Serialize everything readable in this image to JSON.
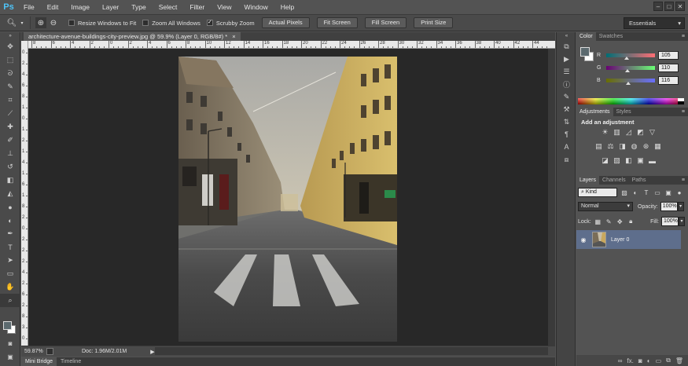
{
  "app": {
    "logo": "Ps"
  },
  "menu": [
    "File",
    "Edit",
    "Image",
    "Layer",
    "Type",
    "Select",
    "Filter",
    "View",
    "Window",
    "Help"
  ],
  "window_controls": {
    "minimize": "–",
    "maximize": "□",
    "close": "✕"
  },
  "options_bar": {
    "resize_windows": "Resize Windows to Fit",
    "zoom_all": "Zoom All Windows",
    "scrubby_zoom": "Scrubby Zoom",
    "scrubby_checked": true,
    "actual_pixels": "Actual Pixels",
    "fit_screen": "Fit Screen",
    "fill_screen": "Fill Screen",
    "print_size": "Print Size",
    "workspace": "Essentials"
  },
  "document": {
    "tab_title": "architecture-avenue-buildings-city-preview.jpg @ 59.9% (Layer 0, RGB/8#) *",
    "tab_close": "×"
  },
  "rulers": {
    "h_labels": [
      "8",
      "6",
      "4",
      "2",
      "0",
      "2",
      "4",
      "6",
      "8",
      "10",
      "12",
      "14",
      "16",
      "18",
      "20",
      "22",
      "24",
      "26",
      "28",
      "30",
      "32",
      "34",
      "36",
      "38",
      "40",
      "42",
      "44"
    ],
    "v_labels": [
      "0",
      "2",
      "4",
      "6",
      "8",
      "1",
      "0",
      "1",
      "2",
      "1",
      "4",
      "1",
      "6",
      "1",
      "8",
      "2",
      "0",
      "2",
      "2",
      "2",
      "4",
      "2",
      "6",
      "2",
      "8",
      "3",
      "0"
    ]
  },
  "status": {
    "zoom": "59.87%",
    "doc": "Doc: 1.96M/2.01M",
    "arrow": "▶"
  },
  "mini": {
    "bridge": "Mini Bridge",
    "timeline": "Timeline"
  },
  "color_panel": {
    "tabs": [
      "Color",
      "Swatches"
    ],
    "r_label": "R",
    "g_label": "G",
    "b_label": "B",
    "r": "105",
    "g": "110",
    "b": "116",
    "fg": "#5c6a6f",
    "bg": "#ffffff"
  },
  "adjustments_panel": {
    "tabs": [
      "Adjustments",
      "Styles"
    ],
    "title": "Add an adjustment"
  },
  "layers_panel": {
    "tabs": [
      "Layers",
      "Channels",
      "Paths"
    ],
    "kind": "Kind",
    "blend_mode": "Normal",
    "opacity_label": "Opacity:",
    "opacity": "100%",
    "lock_label": "Lock:",
    "fill_label": "Fill:",
    "fill": "100%",
    "layers": [
      {
        "name": "Layer 0",
        "visible": true
      }
    ],
    "footer_fx": "fx."
  }
}
